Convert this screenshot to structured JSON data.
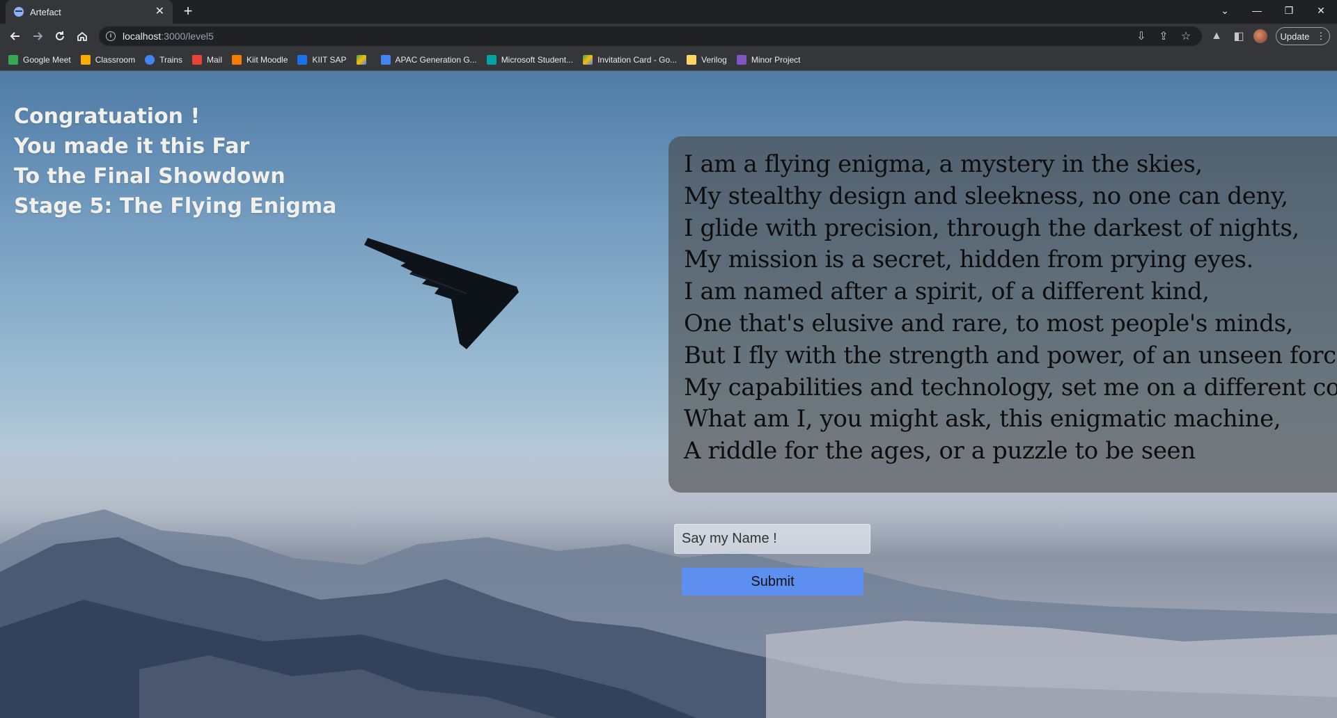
{
  "browser": {
    "tab_title": "Artefact",
    "url_host": "localhost",
    "url_path": ":3000/level5",
    "update_label": "Update"
  },
  "bookmarks": [
    {
      "label": "Google Meet",
      "color": "#34a853"
    },
    {
      "label": "Classroom",
      "color": "#f9ab00"
    },
    {
      "label": "Trains",
      "color": "#4285f4"
    },
    {
      "label": "Mail",
      "color": "#ea4335"
    },
    {
      "label": "Kiit Moodle",
      "color": "#f57c00"
    },
    {
      "label": "KIIT SAP",
      "color": "#1a73e8"
    },
    {
      "label": "",
      "color": "#34a853"
    },
    {
      "label": "APAC Generation G...",
      "color": "#4285f4"
    },
    {
      "label": "Microsoft Student...",
      "color": "#00a4a6"
    },
    {
      "label": "Invitation Card - Go...",
      "color": "#fbbc04"
    },
    {
      "label": "Verilog",
      "color": "#fdd663"
    },
    {
      "label": "Minor Project",
      "color": "#7e57c2"
    }
  ],
  "page": {
    "headline_lines": [
      "Congratuation !",
      "You made it this Far",
      "To the Final Showdown",
      "Stage 5: The Flying Enigma"
    ],
    "poem_lines": [
      "I am a flying enigma, a mystery in the skies,",
      "My stealthy design and sleekness, no one can deny,",
      "I glide with precision, through the darkest of nights,",
      "My mission is a secret, hidden from prying eyes.",
      "I am named after a spirit, of a different kind,",
      "One that's elusive and rare, to most people's minds,",
      "But I fly with the strength and power, of an unseen force,",
      "My capabilities and technology, set me on a different course",
      "What am I, you might ask, this enigmatic machine,",
      "A riddle for the ages, or a puzzle to be seen"
    ],
    "answer_placeholder": "Say my Name !",
    "submit_label": "Submit"
  }
}
